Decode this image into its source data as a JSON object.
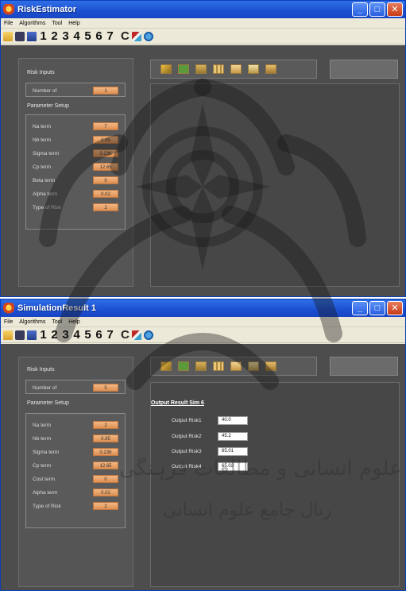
{
  "window1": {
    "title": "RiskEstimator",
    "menu": [
      "File",
      "Algorithms",
      "Tool",
      "Help"
    ],
    "toolbar_numbers": [
      "1",
      "2",
      "3",
      "4",
      "5",
      "6",
      "7"
    ],
    "toolbar_c": "C",
    "risk_inputs": {
      "title": "Risk Inputs",
      "number_label": "Number of",
      "number_value": "1"
    },
    "parameter_setup": {
      "title": "Parameter Setup",
      "rows": [
        {
          "label": "Na term",
          "value": "7"
        },
        {
          "label": "Nb term",
          "value": "0.95"
        },
        {
          "label": "Sigma term",
          "value": "0.236"
        },
        {
          "label": "Cp term",
          "value": "12.65"
        },
        {
          "label": "Beta term",
          "value": "0"
        },
        {
          "label": "Alpha term",
          "value": "0.02"
        },
        {
          "label": "Type of Risk",
          "value": "2"
        }
      ]
    }
  },
  "window2": {
    "title": "SimulationResult 1",
    "menu": [
      "File",
      "Algorithms",
      "Tool",
      "Help"
    ],
    "toolbar_numbers": [
      "1",
      "2",
      "3",
      "4",
      "5",
      "6",
      "7"
    ],
    "toolbar_c": "C",
    "risk_inputs": {
      "title": "Risk Inputs",
      "number_label": "Number of",
      "number_value": "5"
    },
    "parameter_setup": {
      "title": "Parameter Setup",
      "rows": [
        {
          "label": "Na term",
          "value": "2"
        },
        {
          "label": "Nb term",
          "value": "0.95"
        },
        {
          "label": "Sigma term",
          "value": "0.236"
        },
        {
          "label": "Cp term",
          "value": "12.65"
        },
        {
          "label": "Cost term",
          "value": "0"
        },
        {
          "label": "Alpha term",
          "value": "0.02"
        },
        {
          "label": "Type of Risk",
          "value": "2"
        }
      ]
    },
    "output": {
      "title": "Output Result Sim 6",
      "rows": [
        {
          "label": "Output Risk1",
          "value": "40.0"
        },
        {
          "label": "Output Risk2",
          "value": "45.2"
        },
        {
          "label": "Output Risk3",
          "value": "65.01"
        },
        {
          "label": "Output Risk4",
          "value": "65.02"
        }
      ]
    }
  },
  "watermark": {
    "line1": "ثروہشگاه علوم انسانی و مطالعات فرہنگی",
    "line2": "رتال جامع علوم انسانی"
  },
  "colors": {
    "titlebar": "#1c4fd0",
    "client_bg": "#4d4d4d",
    "value_field": "#f3b884"
  }
}
